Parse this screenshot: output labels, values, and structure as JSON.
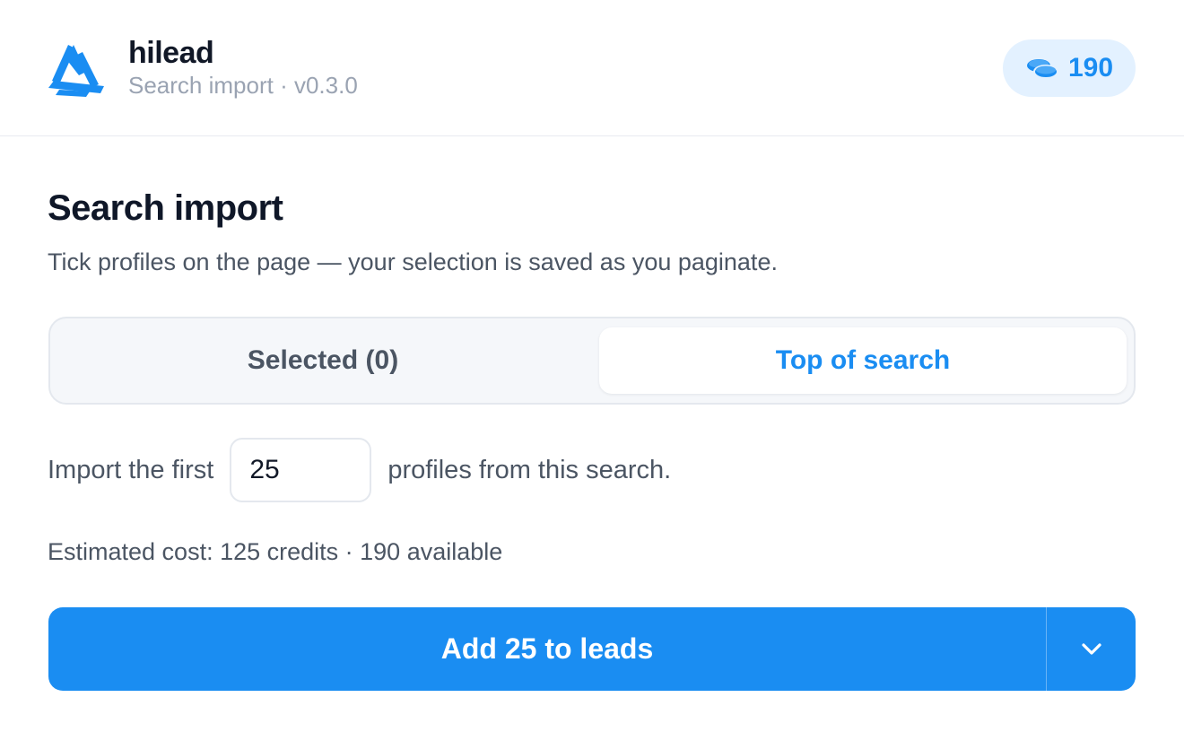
{
  "header": {
    "brand_name": "hilead",
    "subtitle": "Search import · v0.3.0",
    "credits": "190",
    "logo_icon": "hilead-logo",
    "credits_icon": "coins-icon"
  },
  "main": {
    "title": "Search import",
    "description": "Tick profiles on the page — your selection is saved as you paginate.",
    "tabs": [
      {
        "label": "Selected (0)",
        "active": false
      },
      {
        "label": "Top of search",
        "active": true
      }
    ],
    "import_prefix": "Import the first",
    "import_count": "25",
    "import_suffix": "profiles from this search.",
    "cost_text": "Estimated cost: 125 credits · 190 available",
    "action_label": "Add 25 to leads",
    "dropdown_icon": "chevron-down-icon"
  },
  "colors": {
    "accent": "#1a8df2",
    "accent_light": "#e3f1ff",
    "muted_text": "#9aa3b2",
    "body_text": "#4b5563"
  }
}
